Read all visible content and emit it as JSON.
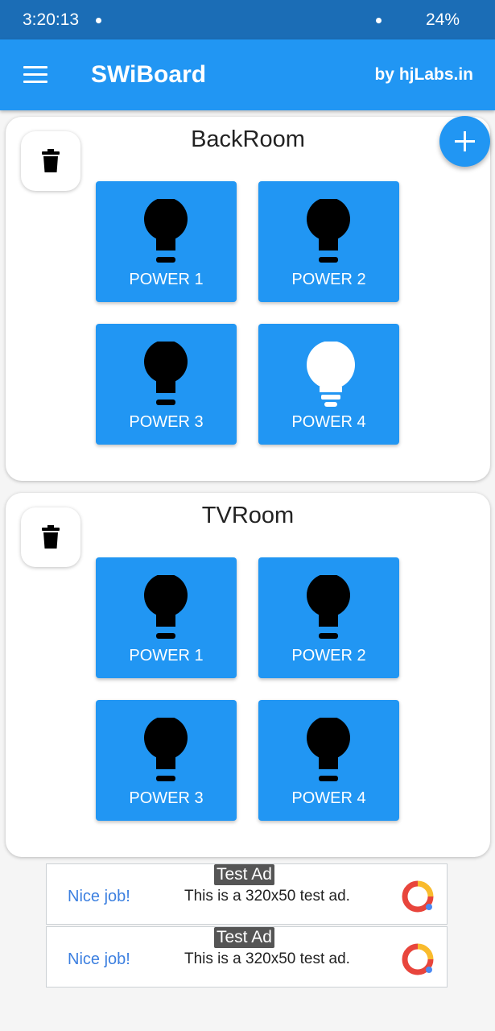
{
  "status_bar": {
    "time": "3:20:13",
    "battery": "24%"
  },
  "app_bar": {
    "title": "SWiBoard",
    "byline": "by hjLabs.in"
  },
  "rooms": [
    {
      "name": "BackRoom",
      "switches": [
        {
          "label": "POWER 1",
          "state": "off"
        },
        {
          "label": "POWER 2",
          "state": "off"
        },
        {
          "label": "POWER 3",
          "state": "off"
        },
        {
          "label": "POWER 4",
          "state": "on"
        }
      ]
    },
    {
      "name": "TVRoom",
      "switches": [
        {
          "label": "POWER 1",
          "state": "off"
        },
        {
          "label": "POWER 2",
          "state": "off"
        },
        {
          "label": "POWER 3",
          "state": "off"
        },
        {
          "label": "POWER 4",
          "state": "off"
        }
      ]
    }
  ],
  "ads": [
    {
      "badge": "Test Ad",
      "headline": "Nice job!",
      "message": "This is a 320x50 test ad."
    },
    {
      "badge": "Test Ad",
      "headline": "Nice job!",
      "message": "This is a 320x50 test ad."
    }
  ],
  "icons": {
    "menu": "menu-icon",
    "delete": "trash-icon",
    "add": "plus-icon",
    "bulb_on": "lightbulb-on-icon",
    "bulb_off": "lightbulb-off-icon",
    "ad_logo": "ad-logo-icon"
  },
  "colors": {
    "primary": "#2196f3",
    "status_bar": "#1b6db6",
    "bulb_on": "#ffffff",
    "bulb_off": "#000000",
    "ad_link": "#3d80e0"
  }
}
